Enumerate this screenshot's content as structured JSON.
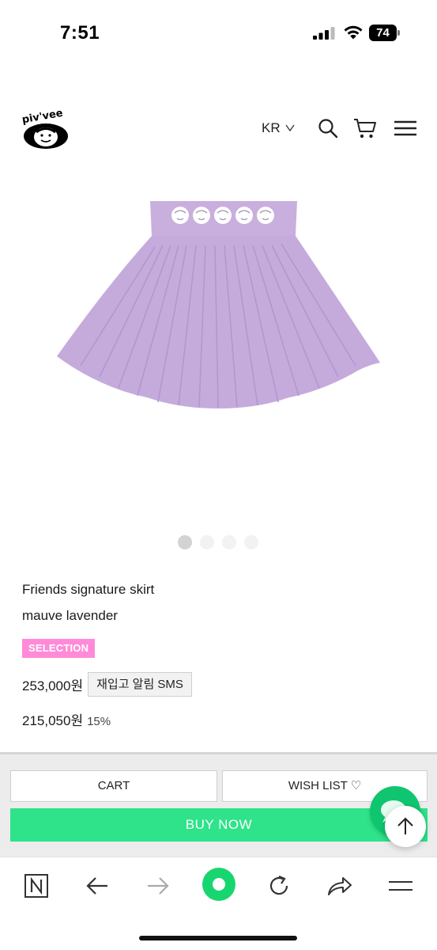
{
  "status_bar": {
    "time": "7:51",
    "battery": "74",
    "icons": [
      "signal-icon",
      "wifi-icon",
      "battery-icon"
    ]
  },
  "header": {
    "logo_text": "piv'vee",
    "language": "KR",
    "icons": [
      "chevron-down-icon",
      "search-icon",
      "cart-icon",
      "menu-icon"
    ]
  },
  "product": {
    "image": "lavender-pleated-skirt",
    "carousel": {
      "count": 4,
      "active": 0
    },
    "name": "Friends signature skirt",
    "color": "mauve lavender",
    "badge": "SELECTION",
    "price": "253,000원",
    "restock_label": "재입고 알림 SMS",
    "sale_price": "215,050원",
    "discount": "15%"
  },
  "actions": {
    "cart_label": "CART",
    "wishlist_label": "WISH LIST ♡",
    "buy_label": "BUY NOW"
  },
  "browser_toolbar": {
    "buttons": [
      "naver-icon",
      "back-arrow-icon",
      "forward-arrow-icon",
      "home-icon",
      "reload-icon",
      "share-icon",
      "menu-icon"
    ]
  },
  "colors": {
    "accent_green": "#2ee389",
    "badge_pink": "#ff8ad8",
    "skirt_lavender": "#c9b1de"
  }
}
